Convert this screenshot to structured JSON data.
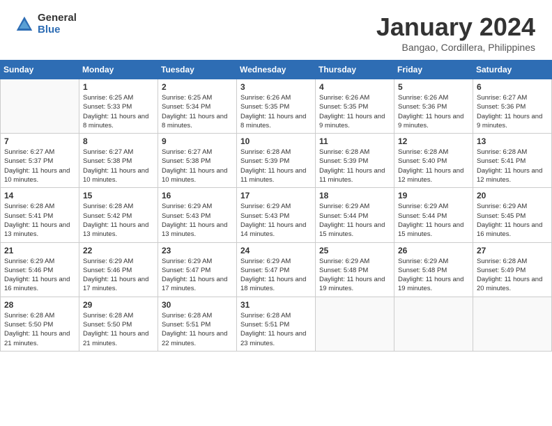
{
  "logo": {
    "general": "General",
    "blue": "Blue"
  },
  "title": {
    "month": "January 2024",
    "location": "Bangao, Cordillera, Philippines"
  },
  "weekdays": [
    "Sunday",
    "Monday",
    "Tuesday",
    "Wednesday",
    "Thursday",
    "Friday",
    "Saturday"
  ],
  "weeks": [
    [
      {
        "day": "",
        "sunrise": "",
        "sunset": "",
        "daylight": ""
      },
      {
        "day": "1",
        "sunrise": "Sunrise: 6:25 AM",
        "sunset": "Sunset: 5:33 PM",
        "daylight": "Daylight: 11 hours and 8 minutes."
      },
      {
        "day": "2",
        "sunrise": "Sunrise: 6:25 AM",
        "sunset": "Sunset: 5:34 PM",
        "daylight": "Daylight: 11 hours and 8 minutes."
      },
      {
        "day": "3",
        "sunrise": "Sunrise: 6:26 AM",
        "sunset": "Sunset: 5:35 PM",
        "daylight": "Daylight: 11 hours and 8 minutes."
      },
      {
        "day": "4",
        "sunrise": "Sunrise: 6:26 AM",
        "sunset": "Sunset: 5:35 PM",
        "daylight": "Daylight: 11 hours and 9 minutes."
      },
      {
        "day": "5",
        "sunrise": "Sunrise: 6:26 AM",
        "sunset": "Sunset: 5:36 PM",
        "daylight": "Daylight: 11 hours and 9 minutes."
      },
      {
        "day": "6",
        "sunrise": "Sunrise: 6:27 AM",
        "sunset": "Sunset: 5:36 PM",
        "daylight": "Daylight: 11 hours and 9 minutes."
      }
    ],
    [
      {
        "day": "7",
        "sunrise": "Sunrise: 6:27 AM",
        "sunset": "Sunset: 5:37 PM",
        "daylight": "Daylight: 11 hours and 10 minutes."
      },
      {
        "day": "8",
        "sunrise": "Sunrise: 6:27 AM",
        "sunset": "Sunset: 5:38 PM",
        "daylight": "Daylight: 11 hours and 10 minutes."
      },
      {
        "day": "9",
        "sunrise": "Sunrise: 6:27 AM",
        "sunset": "Sunset: 5:38 PM",
        "daylight": "Daylight: 11 hours and 10 minutes."
      },
      {
        "day": "10",
        "sunrise": "Sunrise: 6:28 AM",
        "sunset": "Sunset: 5:39 PM",
        "daylight": "Daylight: 11 hours and 11 minutes."
      },
      {
        "day": "11",
        "sunrise": "Sunrise: 6:28 AM",
        "sunset": "Sunset: 5:39 PM",
        "daylight": "Daylight: 11 hours and 11 minutes."
      },
      {
        "day": "12",
        "sunrise": "Sunrise: 6:28 AM",
        "sunset": "Sunset: 5:40 PM",
        "daylight": "Daylight: 11 hours and 12 minutes."
      },
      {
        "day": "13",
        "sunrise": "Sunrise: 6:28 AM",
        "sunset": "Sunset: 5:41 PM",
        "daylight": "Daylight: 11 hours and 12 minutes."
      }
    ],
    [
      {
        "day": "14",
        "sunrise": "Sunrise: 6:28 AM",
        "sunset": "Sunset: 5:41 PM",
        "daylight": "Daylight: 11 hours and 13 minutes."
      },
      {
        "day": "15",
        "sunrise": "Sunrise: 6:28 AM",
        "sunset": "Sunset: 5:42 PM",
        "daylight": "Daylight: 11 hours and 13 minutes."
      },
      {
        "day": "16",
        "sunrise": "Sunrise: 6:29 AM",
        "sunset": "Sunset: 5:43 PM",
        "daylight": "Daylight: 11 hours and 13 minutes."
      },
      {
        "day": "17",
        "sunrise": "Sunrise: 6:29 AM",
        "sunset": "Sunset: 5:43 PM",
        "daylight": "Daylight: 11 hours and 14 minutes."
      },
      {
        "day": "18",
        "sunrise": "Sunrise: 6:29 AM",
        "sunset": "Sunset: 5:44 PM",
        "daylight": "Daylight: 11 hours and 15 minutes."
      },
      {
        "day": "19",
        "sunrise": "Sunrise: 6:29 AM",
        "sunset": "Sunset: 5:44 PM",
        "daylight": "Daylight: 11 hours and 15 minutes."
      },
      {
        "day": "20",
        "sunrise": "Sunrise: 6:29 AM",
        "sunset": "Sunset: 5:45 PM",
        "daylight": "Daylight: 11 hours and 16 minutes."
      }
    ],
    [
      {
        "day": "21",
        "sunrise": "Sunrise: 6:29 AM",
        "sunset": "Sunset: 5:46 PM",
        "daylight": "Daylight: 11 hours and 16 minutes."
      },
      {
        "day": "22",
        "sunrise": "Sunrise: 6:29 AM",
        "sunset": "Sunset: 5:46 PM",
        "daylight": "Daylight: 11 hours and 17 minutes."
      },
      {
        "day": "23",
        "sunrise": "Sunrise: 6:29 AM",
        "sunset": "Sunset: 5:47 PM",
        "daylight": "Daylight: 11 hours and 17 minutes."
      },
      {
        "day": "24",
        "sunrise": "Sunrise: 6:29 AM",
        "sunset": "Sunset: 5:47 PM",
        "daylight": "Daylight: 11 hours and 18 minutes."
      },
      {
        "day": "25",
        "sunrise": "Sunrise: 6:29 AM",
        "sunset": "Sunset: 5:48 PM",
        "daylight": "Daylight: 11 hours and 19 minutes."
      },
      {
        "day": "26",
        "sunrise": "Sunrise: 6:29 AM",
        "sunset": "Sunset: 5:48 PM",
        "daylight": "Daylight: 11 hours and 19 minutes."
      },
      {
        "day": "27",
        "sunrise": "Sunrise: 6:28 AM",
        "sunset": "Sunset: 5:49 PM",
        "daylight": "Daylight: 11 hours and 20 minutes."
      }
    ],
    [
      {
        "day": "28",
        "sunrise": "Sunrise: 6:28 AM",
        "sunset": "Sunset: 5:50 PM",
        "daylight": "Daylight: 11 hours and 21 minutes."
      },
      {
        "day": "29",
        "sunrise": "Sunrise: 6:28 AM",
        "sunset": "Sunset: 5:50 PM",
        "daylight": "Daylight: 11 hours and 21 minutes."
      },
      {
        "day": "30",
        "sunrise": "Sunrise: 6:28 AM",
        "sunset": "Sunset: 5:51 PM",
        "daylight": "Daylight: 11 hours and 22 minutes."
      },
      {
        "day": "31",
        "sunrise": "Sunrise: 6:28 AM",
        "sunset": "Sunset: 5:51 PM",
        "daylight": "Daylight: 11 hours and 23 minutes."
      },
      {
        "day": "",
        "sunrise": "",
        "sunset": "",
        "daylight": ""
      },
      {
        "day": "",
        "sunrise": "",
        "sunset": "",
        "daylight": ""
      },
      {
        "day": "",
        "sunrise": "",
        "sunset": "",
        "daylight": ""
      }
    ]
  ]
}
